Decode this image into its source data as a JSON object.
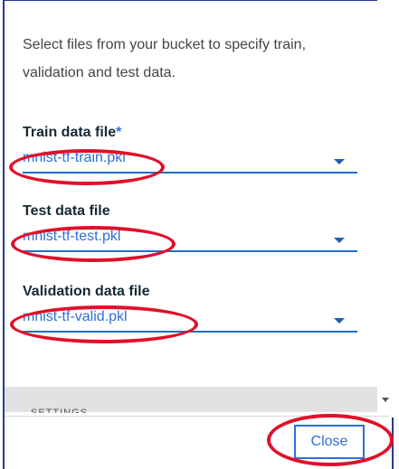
{
  "dialog": {
    "description": "Select files from your bucket to specify train, validation and test data.",
    "fields": [
      {
        "label": "Train data file",
        "required_marker": "*",
        "value": "mnist-tf-train.pkl"
      },
      {
        "label": "Test data file",
        "value": "mnist-tf-test.pkl"
      },
      {
        "label": "Validation data file",
        "value": "mnist-tf-valid.pkl"
      }
    ],
    "settings_section_label": "SETTINGS",
    "close_label": "Close"
  },
  "colors": {
    "accent": "#2e6fd8",
    "annotation": "#e0102a",
    "frame": "#2b3a8c"
  },
  "icons": {
    "dropdown": "caret-down-icon",
    "scroll": "scroll-down-arrow-icon"
  }
}
